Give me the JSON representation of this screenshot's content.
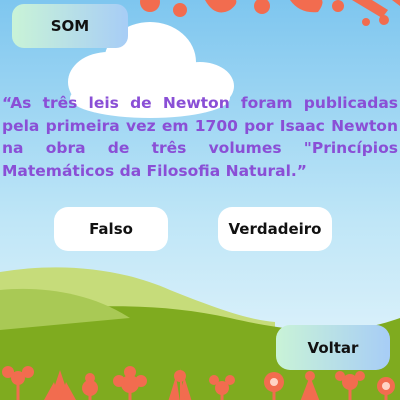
{
  "buttons": {
    "sound_label": "SOM",
    "false_label": "Falso",
    "true_label": "Verdadeiro",
    "back_label": "Voltar"
  },
  "question": {
    "text": "“As três leis de Newton foram publicadas pela primeira vez em 1700 por Isaac Newton na obra de três volumes \"Princípios Matemáticos da Filosofia Natural.”"
  },
  "colors": {
    "sky_top": "#7ec6ef",
    "question_text": "#8a4fd6",
    "flowers": "#f26c4f",
    "hill_light": "#c6dc7a",
    "hill_dark": "#7fab1f",
    "button_gradient_start": "#c9f3d7",
    "button_gradient_end": "#a7cdf6"
  }
}
